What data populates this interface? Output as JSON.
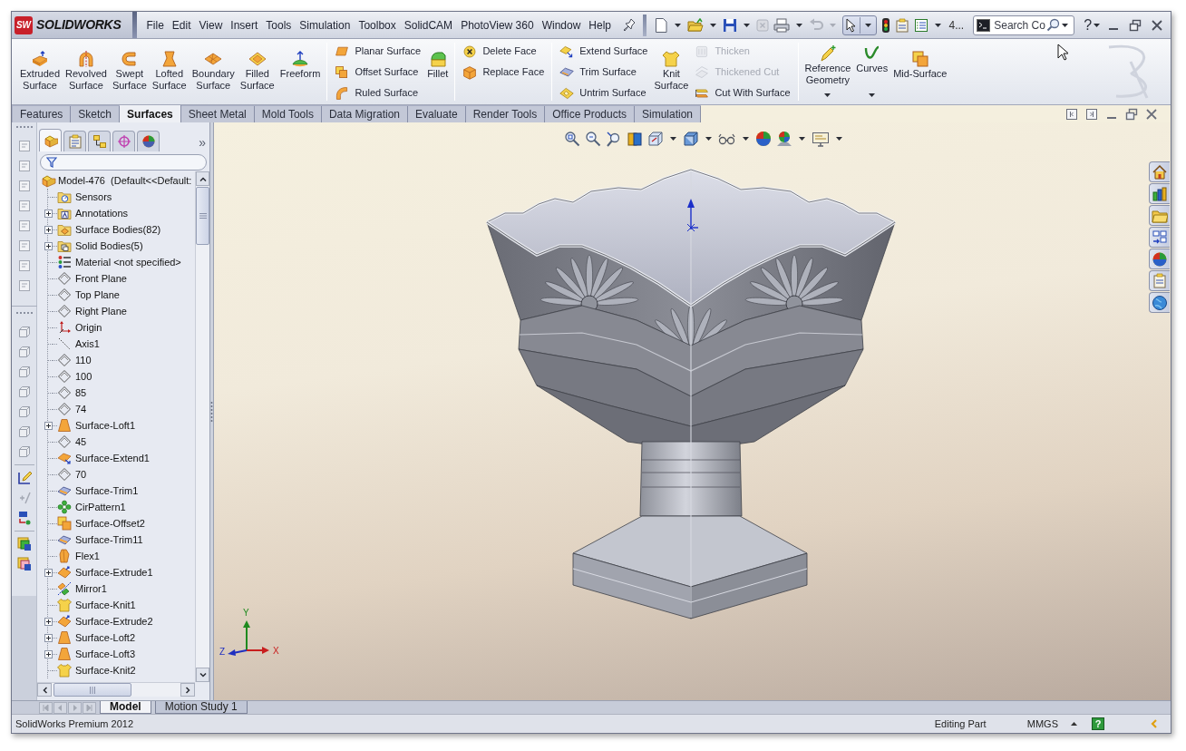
{
  "app_bar": {
    "logo_badge": "SW",
    "logo_text": "SOLIDWORKS",
    "menu": [
      "File",
      "Edit",
      "View",
      "Insert",
      "Tools",
      "Simulation",
      "Toolbox",
      "SolidCAM",
      "PhotoView 360",
      "Window",
      "Help"
    ],
    "overflow_label": "4...",
    "search": {
      "placeholder": "Search Co"
    },
    "help_glyph": "?"
  },
  "ribbon": {
    "groups": [
      [
        {
          "kind": "large",
          "label": "Extruded Surface",
          "disabled": false,
          "dropdown": false
        },
        {
          "kind": "large",
          "label": "Revolved Surface",
          "disabled": false,
          "dropdown": false
        },
        {
          "kind": "large",
          "label": "Swept Surface",
          "disabled": false,
          "dropdown": false
        },
        {
          "kind": "large",
          "label": "Lofted Surface",
          "disabled": false,
          "dropdown": false
        },
        {
          "kind": "large",
          "label": "Boundary Surface",
          "disabled": false,
          "dropdown": false
        },
        {
          "kind": "large",
          "label": "Filled Surface",
          "disabled": false,
          "dropdown": false
        },
        {
          "kind": "large",
          "label": "Freeform",
          "disabled": false,
          "dropdown": false
        }
      ],
      [
        {
          "kind": "stack",
          "items": [
            {
              "label": "Planar Surface",
              "disabled": false
            },
            {
              "label": "Offset Surface",
              "disabled": false
            },
            {
              "label": "Ruled Surface",
              "disabled": false
            }
          ]
        },
        {
          "kind": "large",
          "label": "Fillet",
          "disabled": false,
          "dropdown": false
        }
      ],
      [
        {
          "kind": "stack",
          "items": [
            {
              "label": "Delete Face",
              "disabled": false
            },
            {
              "label": "Replace Face",
              "disabled": false
            }
          ]
        }
      ],
      [
        {
          "kind": "stack",
          "items": [
            {
              "label": "Extend Surface",
              "disabled": false
            },
            {
              "label": "Trim Surface",
              "disabled": false
            },
            {
              "label": "Untrim Surface",
              "disabled": false
            }
          ]
        },
        {
          "kind": "large",
          "label": "Knit Surface",
          "disabled": false,
          "dropdown": false
        },
        {
          "kind": "stack",
          "items": [
            {
              "label": "Thicken",
              "disabled": true
            },
            {
              "label": "Thickened Cut",
              "disabled": true
            },
            {
              "label": "Cut With Surface",
              "disabled": false
            }
          ]
        }
      ],
      [
        {
          "kind": "large",
          "label": "Reference Geometry",
          "disabled": false,
          "dropdown": true
        },
        {
          "kind": "large",
          "label": "Curves",
          "disabled": false,
          "dropdown": true
        },
        {
          "kind": "large",
          "label": "Mid-Surface",
          "disabled": false,
          "dropdown": false
        }
      ]
    ]
  },
  "command_tabs": [
    {
      "label": "Features",
      "selected": false
    },
    {
      "label": "Sketch",
      "selected": false
    },
    {
      "label": "Surfaces",
      "selected": true
    },
    {
      "label": "Sheet Metal",
      "selected": false
    },
    {
      "label": "Mold Tools",
      "selected": false
    },
    {
      "label": "Data Migration",
      "selected": false
    },
    {
      "label": "Evaluate",
      "selected": false
    },
    {
      "label": "Render Tools",
      "selected": false
    },
    {
      "label": "Office Products",
      "selected": false
    },
    {
      "label": "Simulation",
      "selected": false
    }
  ],
  "feature_manager": {
    "panel_tabs": [
      {
        "kind": "tree",
        "selected": true
      },
      {
        "kind": "property",
        "selected": false
      },
      {
        "kind": "config",
        "selected": false
      },
      {
        "kind": "dimxpert",
        "selected": false
      },
      {
        "kind": "display",
        "selected": false
      }
    ],
    "more_glyph": "»",
    "tree": {
      "kind": "part",
      "label": "Model-476  (Default<<Default:",
      "children": [
        {
          "kind": "sensors",
          "label": "Sensors",
          "collapsed": false
        },
        {
          "kind": "annotations",
          "label": "Annotations",
          "collapsed": true
        },
        {
          "kind": "surfaces",
          "label": "Surface Bodies(82)",
          "collapsed": true
        },
        {
          "kind": "solids",
          "label": "Solid Bodies(5)",
          "collapsed": true
        },
        {
          "kind": "material",
          "label": "Material <not specified>",
          "collapsed": false
        },
        {
          "kind": "plane",
          "label": "Front Plane",
          "collapsed": false
        },
        {
          "kind": "plane",
          "label": "Top Plane",
          "collapsed": false
        },
        {
          "kind": "plane",
          "label": "Right Plane",
          "collapsed": false
        },
        {
          "kind": "origin",
          "label": "Origin",
          "collapsed": false
        },
        {
          "kind": "axis",
          "label": "Axis1",
          "collapsed": false
        },
        {
          "kind": "plane",
          "label": "110",
          "collapsed": false
        },
        {
          "kind": "plane",
          "label": "100",
          "collapsed": false
        },
        {
          "kind": "plane",
          "label": "85",
          "collapsed": false
        },
        {
          "kind": "plane",
          "label": "74",
          "collapsed": false
        },
        {
          "kind": "loft",
          "label": "Surface-Loft1",
          "collapsed": true
        },
        {
          "kind": "plane",
          "label": "45",
          "collapsed": false
        },
        {
          "kind": "extend",
          "label": "Surface-Extend1",
          "collapsed": false
        },
        {
          "kind": "plane",
          "label": "70",
          "collapsed": false
        },
        {
          "kind": "trim",
          "label": "Surface-Trim1",
          "collapsed": false
        },
        {
          "kind": "pattern",
          "label": "CirPattern1",
          "collapsed": false
        },
        {
          "kind": "offset",
          "label": "Surface-Offset2",
          "collapsed": false
        },
        {
          "kind": "trim",
          "label": "Surface-Trim11",
          "collapsed": false
        },
        {
          "kind": "flex",
          "label": "Flex1",
          "collapsed": false
        },
        {
          "kind": "extrude",
          "label": "Surface-Extrude1",
          "collapsed": true
        },
        {
          "kind": "mirror",
          "label": "Mirror1",
          "collapsed": false
        },
        {
          "kind": "knit",
          "label": "Surface-Knit1",
          "collapsed": false
        },
        {
          "kind": "extrude",
          "label": "Surface-Extrude2",
          "collapsed": true
        },
        {
          "kind": "loft",
          "label": "Surface-Loft2",
          "collapsed": true
        },
        {
          "kind": "loft",
          "label": "Surface-Loft3",
          "collapsed": true
        },
        {
          "kind": "knit",
          "label": "Surface-Knit2",
          "collapsed": false
        }
      ]
    }
  },
  "viewport": {
    "axis_labels": [
      {
        "kind": "y",
        "label": "Y"
      },
      {
        "kind": "z",
        "label": "Z"
      },
      {
        "kind": "x",
        "label": "X"
      }
    ]
  },
  "bottom_tabs": [
    {
      "label": "Model",
      "selected": true
    },
    {
      "label": "Motion Study 1",
      "selected": false
    }
  ],
  "status_bar": {
    "product": "SolidWorks Premium 2012",
    "mode": "Editing Part",
    "units": "MMGS",
    "help_glyph": "?"
  }
}
